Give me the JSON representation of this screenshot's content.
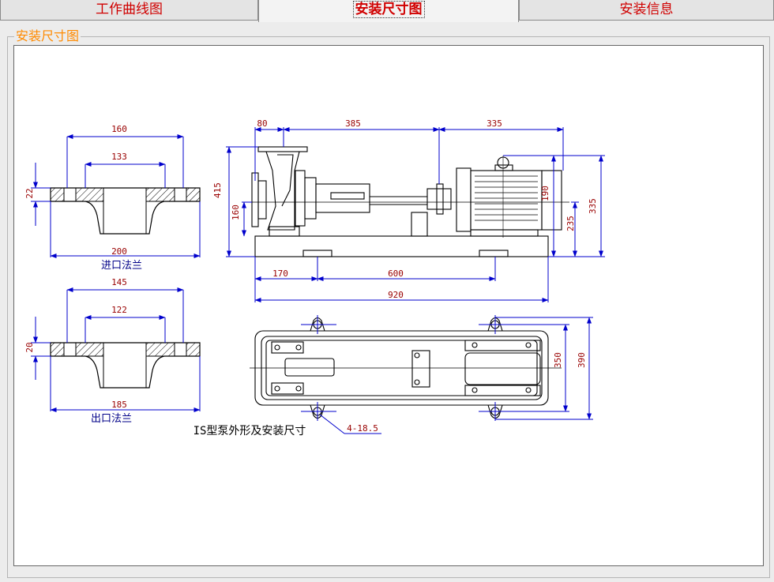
{
  "tabs": [
    {
      "label": "工作曲线图",
      "active": false
    },
    {
      "label": "安装尺寸图",
      "active": true
    },
    {
      "label": "安装信息",
      "active": false
    }
  ],
  "group": {
    "title": "安装尺寸图"
  },
  "drawing": {
    "caption": "IS型泵外形及安装尺寸",
    "inlet": {
      "title": "进口法兰",
      "d_outer": "160",
      "d_inner": "133",
      "thickness": "22",
      "width": "200"
    },
    "outlet": {
      "title": "出口法兰",
      "d_outer": "145",
      "d_inner": "122",
      "thickness": "20",
      "width": "185"
    },
    "side": {
      "d80": "80",
      "d385": "385",
      "d335": "335",
      "d415": "415",
      "d160": "160",
      "d190": "190",
      "d235": "235",
      "d335v": "335",
      "d170": "170",
      "d600": "600",
      "d920": "920"
    },
    "plan": {
      "d350": "350",
      "d390": "390",
      "holes": "4-18.5"
    }
  },
  "colors": {
    "tab_text": "#d00000",
    "legend": "#ff8a00",
    "dimension": "#0000cc",
    "dim_text": "#990000",
    "line": "#000000"
  }
}
